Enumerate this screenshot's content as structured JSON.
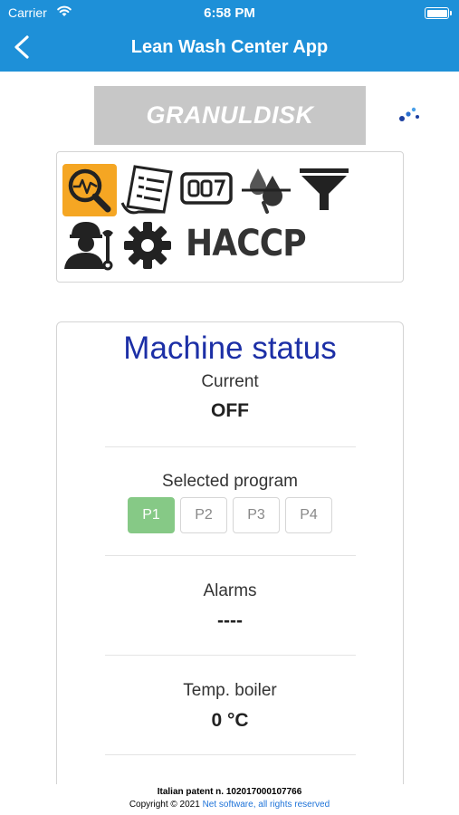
{
  "statusbar": {
    "carrier": "Carrier",
    "time": "6:58 PM",
    "wifi_icon": "wifi-icon",
    "battery_icon": "battery-icon"
  },
  "nav": {
    "title": "Lean Wash Center App",
    "back_icon": "chevron-left-icon",
    "color": "#1e90d8"
  },
  "logo": {
    "text": "GRANULDISK"
  },
  "icons": {
    "items": [
      {
        "name": "diagnostics-icon",
        "selected": true
      },
      {
        "name": "document-list-icon",
        "selected": false
      },
      {
        "name": "counter-icon",
        "selected": false
      },
      {
        "name": "water-drops-icon",
        "selected": false
      },
      {
        "name": "filter-funnel-icon",
        "selected": false
      },
      {
        "name": "technician-icon",
        "selected": false
      },
      {
        "name": "gear-icon",
        "selected": false
      }
    ],
    "haccp_label": "HACCP",
    "selected_color": "#f5a623"
  },
  "status": {
    "title": "Machine status",
    "current_label": "Current",
    "current_value": "OFF",
    "program_label": "Selected program",
    "programs": [
      "P1",
      "P2",
      "P3",
      "P4"
    ],
    "selected_program": "P1",
    "alarms_label": "Alarms",
    "alarms_value": "----",
    "temp_label": "Temp. boiler",
    "temp_value": "0 °C",
    "active_color": "#86c986"
  },
  "footer": {
    "patent": "Italian patent n. 102017000107766",
    "copyright_prefix": "Copyright © 2021 ",
    "copyright_link": "Net software, all rights reserved"
  }
}
